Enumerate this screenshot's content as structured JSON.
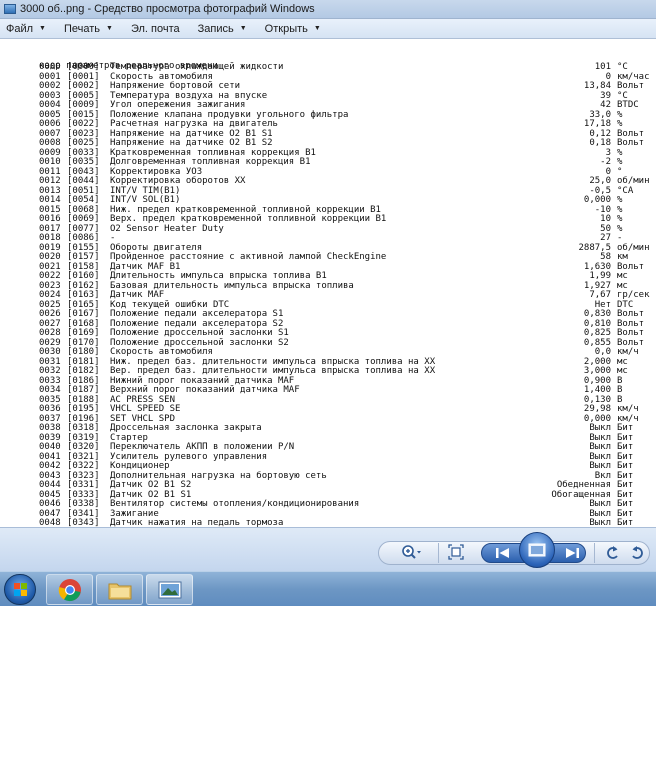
{
  "window": {
    "title": "3000 об..png - Средство просмотра фотографий Windows"
  },
  "menubar": {
    "items": [
      {
        "label": "Файл"
      },
      {
        "label": "Печать"
      },
      {
        "label": "Эл. почта"
      },
      {
        "label": "Запись"
      },
      {
        "label": "Открыть"
      }
    ]
  },
  "document": {
    "title": "кадр параметров реального времени",
    "rows": [
      {
        "idx": "0000",
        "code": "[0000]",
        "name": "Температура охлаждающей жидкости",
        "value": "101",
        "unit": "°C"
      },
      {
        "idx": "0001",
        "code": "[0001]",
        "name": "Скорость автомобиля",
        "value": "0",
        "unit": "км/час"
      },
      {
        "idx": "0002",
        "code": "[0002]",
        "name": "Напряжение бортовой сети",
        "value": "13,84",
        "unit": "Вольт"
      },
      {
        "idx": "0003",
        "code": "[0005]",
        "name": "Температура воздуха на впуске",
        "value": "39",
        "unit": "°C"
      },
      {
        "idx": "0004",
        "code": "[0009]",
        "name": "Угол опережения зажигания",
        "value": "42",
        "unit": "BTDC"
      },
      {
        "idx": "0005",
        "code": "[0015]",
        "name": "Положение клапана продувки угольного фильтра",
        "value": "33,0",
        "unit": "%"
      },
      {
        "idx": "0006",
        "code": "[0022]",
        "name": "Расчетная нагрузка на двигатель",
        "value": "17,18",
        "unit": "%"
      },
      {
        "idx": "0007",
        "code": "[0023]",
        "name": "Напряжение на датчике O2 B1 S1",
        "value": "0,12",
        "unit": "Вольт"
      },
      {
        "idx": "0008",
        "code": "[0025]",
        "name": "Напряжение на датчике O2 B1 S2",
        "value": "0,18",
        "unit": "Вольт"
      },
      {
        "idx": "0009",
        "code": "[0033]",
        "name": "Кратковременная топливная коррекция B1",
        "value": "3",
        "unit": "%"
      },
      {
        "idx": "0010",
        "code": "[0035]",
        "name": "Долговременная топливная коррекция B1",
        "value": "-2",
        "unit": "%"
      },
      {
        "idx": "0011",
        "code": "[0043]",
        "name": "Корректировка УОЗ",
        "value": "0",
        "unit": "°"
      },
      {
        "idx": "0012",
        "code": "[0044]",
        "name": "Корректировка оборотов XX",
        "value": "25,0",
        "unit": "об/мин"
      },
      {
        "idx": "0013",
        "code": "[0051]",
        "name": "INT/V TIM(B1)",
        "value": "-0,5",
        "unit": "°CA"
      },
      {
        "idx": "0014",
        "code": "[0054]",
        "name": "INT/V SOL(B1)",
        "value": "0,000",
        "unit": "%"
      },
      {
        "idx": "0015",
        "code": "[0068]",
        "name": "Ниж. предел кратковременной топливной коррекции B1",
        "value": "-10",
        "unit": "%"
      },
      {
        "idx": "0016",
        "code": "[0069]",
        "name": "Верх. предел кратковременной топливной коррекции B1",
        "value": "10",
        "unit": "%"
      },
      {
        "idx": "0017",
        "code": "[0077]",
        "name": "O2 Sensor Heater Duty",
        "value": "50",
        "unit": "%"
      },
      {
        "idx": "0018",
        "code": "[0086]",
        "name": "-",
        "value": "27",
        "unit": "-"
      },
      {
        "idx": "0019",
        "code": "[0155]",
        "name": "Обороты двигателя",
        "value": "2887,5",
        "unit": "об/мин"
      },
      {
        "idx": "0020",
        "code": "[0157]",
        "name": "Пройденное расстояние с активной лампой CheckEngine",
        "value": "58",
        "unit": "км"
      },
      {
        "idx": "0021",
        "code": "[0158]",
        "name": "Датчик MAF B1",
        "value": "1,630",
        "unit": "Вольт"
      },
      {
        "idx": "0022",
        "code": "[0160]",
        "name": "Длительность импульса впрыска топлива B1",
        "value": "1,99",
        "unit": "мс"
      },
      {
        "idx": "0023",
        "code": "[0162]",
        "name": "Базовая длительность импульса впрыска топлива",
        "value": "1,927",
        "unit": "мс"
      },
      {
        "idx": "0024",
        "code": "[0163]",
        "name": "Датчик MAF",
        "value": "7,67",
        "unit": "гр/сек"
      },
      {
        "idx": "0025",
        "code": "[0165]",
        "name": "Код текущей ошибки DTC",
        "value": "Нет",
        "unit": "DTC"
      },
      {
        "idx": "0026",
        "code": "[0167]",
        "name": "Положение педали акселератора S1",
        "value": "0,830",
        "unit": "Вольт"
      },
      {
        "idx": "0027",
        "code": "[0168]",
        "name": "Положение педали акселератора S2",
        "value": "0,810",
        "unit": "Вольт"
      },
      {
        "idx": "0028",
        "code": "[0169]",
        "name": "Положение дроссельной заслонки S1",
        "value": "0,825",
        "unit": "Вольт"
      },
      {
        "idx": "0029",
        "code": "[0170]",
        "name": "Положение дроссельной заслонки S2",
        "value": "0,855",
        "unit": "Вольт"
      },
      {
        "idx": "0030",
        "code": "[0180]",
        "name": "Скорость автомобиля",
        "value": "0,0",
        "unit": "км/ч"
      },
      {
        "idx": "0031",
        "code": "[0181]",
        "name": "Ниж. предел баз. длительности импульса впрыска топлива на XX",
        "value": "2,000",
        "unit": "мс"
      },
      {
        "idx": "0032",
        "code": "[0182]",
        "name": "Вер. предел баз. длительности импульса впрыска топлива на XX",
        "value": "3,000",
        "unit": "мс"
      },
      {
        "idx": "0033",
        "code": "[0186]",
        "name": "Нижний порог показаний датчика MAF",
        "value": "0,900",
        "unit": "В"
      },
      {
        "idx": "0034",
        "code": "[0187]",
        "name": "Верхний порог показаний датчика MAF",
        "value": "1,400",
        "unit": "В"
      },
      {
        "idx": "0035",
        "code": "[0188]",
        "name": "AC PRESS SEN",
        "value": "0,130",
        "unit": "В"
      },
      {
        "idx": "0036",
        "code": "[0195]",
        "name": "VHCL SPEED SE",
        "value": "29,98",
        "unit": "км/ч"
      },
      {
        "idx": "0037",
        "code": "[0196]",
        "name": "SET VHCL SPD",
        "value": "0,000",
        "unit": "км/ч"
      },
      {
        "idx": "0038",
        "code": "[0318]",
        "name": "Дроссельная заслонка закрыта",
        "value": "Выкл",
        "unit": "Бит"
      },
      {
        "idx": "0039",
        "code": "[0319]",
        "name": "Стартер",
        "value": "Выкл",
        "unit": "Бит"
      },
      {
        "idx": "0040",
        "code": "[0320]",
        "name": "Переключатель АКПП в положении P/N",
        "value": "Выкл",
        "unit": "Бит"
      },
      {
        "idx": "0041",
        "code": "[0321]",
        "name": "Усилитель рулевого управления",
        "value": "Выкл",
        "unit": "Бит"
      },
      {
        "idx": "0042",
        "code": "[0322]",
        "name": "Кондиционер",
        "value": "Выкл",
        "unit": "Бит"
      },
      {
        "idx": "0043",
        "code": "[0323]",
        "name": "Дополнительная нагрузка на бортовую сеть",
        "value": "Вкл",
        "unit": "Бит"
      },
      {
        "idx": "0044",
        "code": "[0331]",
        "name": "Датчик O2 B1 S2",
        "value": "Обедненная",
        "unit": "Бит"
      },
      {
        "idx": "0045",
        "code": "[0333]",
        "name": "Датчик O2 B1 S1",
        "value": "Обогащенная",
        "unit": "Бит"
      },
      {
        "idx": "0046",
        "code": "[0338]",
        "name": "Вентилятор системы отопления/кондиционирования",
        "value": "Выкл",
        "unit": "Бит"
      },
      {
        "idx": "0047",
        "code": "[0341]",
        "name": "Зажигание",
        "value": "Выкл",
        "unit": "Бит"
      },
      {
        "idx": "0048",
        "code": "[0343]",
        "name": "Датчик нажатия на педаль тормоза",
        "value": "Выкл",
        "unit": "Бит"
      }
    ]
  },
  "toolbar": {
    "zoom_icon": "magnifier-icon",
    "fit_icon": "actual-size-icon",
    "prev_icon": "previous-icon",
    "slideshow_icon": "slideshow-icon",
    "next_icon": "next-icon",
    "rotate_ccw_icon": "rotate-left-icon",
    "rotate_cw_icon": "rotate-right-icon"
  },
  "taskbar": {
    "items": [
      "start-orb",
      "chrome-icon",
      "explorer-icon",
      "photo-viewer-icon"
    ]
  },
  "colors": {
    "titlebar": "#c8d8ec",
    "menubar": "#dfe9f6",
    "toolbar": "#cfdcee",
    "taskbar": "#7aa3cf",
    "accent": "#2a62b8"
  }
}
